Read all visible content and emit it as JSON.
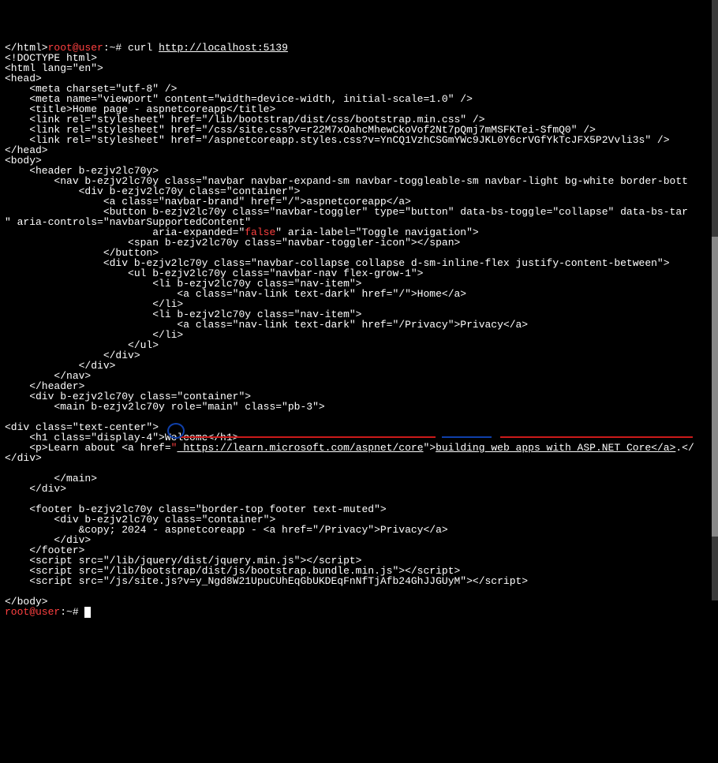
{
  "prompt1_user": "root@user",
  "prompt1_sep": ":~# ",
  "command": "curl ",
  "url": "http://localhost:5139",
  "html_output": {
    "l01": "</html><!DOCTYPE html>",
    "l02": "<html lang=\"en\">",
    "l03": "<head>",
    "l04": "    <meta charset=\"utf-8\" />",
    "l05": "    <meta name=\"viewport\" content=\"width=device-width, initial-scale=1.0\" />",
    "l06": "    <title>Home page - aspnetcoreapp</title>",
    "l07": "    <link rel=\"stylesheet\" href=\"/lib/bootstrap/dist/css/bootstrap.min.css\" />",
    "l08": "    <link rel=\"stylesheet\" href=\"/css/site.css?v=r22M7xOahcMhewCkoVof2Nt7pQmj7mMSFKTei-SfmQ0\" />",
    "l09": "    <link rel=\"stylesheet\" href=\"/aspnetcoreapp.styles.css?v=YnCQ1VzhCSGmYWc9JKL0Y6crVGfYkTcJFX5P2Vvli3s\" />",
    "l10": "</head>",
    "l11": "<body>",
    "l12": "    <header b-ezjv2lc70y>",
    "l13": "        <nav b-ezjv2lc70y class=\"navbar navbar-expand-sm navbar-toggleable-sm navbar-light bg-white border-bott",
    "l14": "            <div b-ezjv2lc70y class=\"container\">",
    "l15": "                <a class=\"navbar-brand\" href=\"/\">aspnetcoreapp</a>",
    "l16": "                <button b-ezjv2lc70y class=\"navbar-toggler\" type=\"button\" data-bs-toggle=\"collapse\" data-bs-tar",
    "l17": "\" aria-controls=\"navbarSupportedContent\"",
    "l18_a": "                        aria-expanded=\"",
    "l18_false": "false",
    "l18_b": "\" aria-label=\"Toggle navigation\">",
    "l19": "                    <span b-ezjv2lc70y class=\"navbar-toggler-icon\"></span>",
    "l20": "                </button>",
    "l21": "                <div b-ezjv2lc70y class=\"navbar-collapse collapse d-sm-inline-flex justify-content-between\">",
    "l22": "                    <ul b-ezjv2lc70y class=\"navbar-nav flex-grow-1\">",
    "l23": "                        <li b-ezjv2lc70y class=\"nav-item\">",
    "l24": "                            <a class=\"nav-link text-dark\" href=\"/\">Home</a>",
    "l25": "                        </li>",
    "l26": "                        <li b-ezjv2lc70y class=\"nav-item\">",
    "l27": "                            <a class=\"nav-link text-dark\" href=\"/Privacy\">Privacy</a>",
    "l28": "                        </li>",
    "l29": "                    </ul>",
    "l30": "                </div>",
    "l31": "            </div>",
    "l32": "        </nav>",
    "l33": "    </header>",
    "l34": "    <div b-ezjv2lc70y class=\"container\">",
    "l35": "        <main b-ezjv2lc70y role=\"main\" class=\"pb-3\">",
    "l36": "",
    "l37": "<div class=\"text-center\">",
    "l38": "    <h1 class=\"display-4\">Welcome</h1>",
    "l39_a": "    <p>Learn about <a href=",
    "l39_url": " https://learn.microsoft.com/aspnet/core",
    "l39_b": "\">",
    "l39_link": "building web apps with ASP.NET Core</a>",
    "l39_c": ".</",
    "l40": "</div>",
    "l41": "",
    "l42": "        </main>",
    "l43": "    </div>",
    "l44": "",
    "l45": "    <footer b-ezjv2lc70y class=\"border-top footer text-muted\">",
    "l46": "        <div b-ezjv2lc70y class=\"container\">",
    "l47": "            &copy; 2024 - aspnetcoreapp - <a href=\"/Privacy\">Privacy</a>",
    "l48": "        </div>",
    "l49": "    </footer>",
    "l50": "    <script src=\"/lib/jquery/dist/jquery.min.js\"></scr",
    "l50b": "ipt>",
    "l51": "    <script src=\"/lib/bootstrap/dist/js/bootstrap.bundle.min.js\"></scr",
    "l51b": "ipt>",
    "l52": "    <script src=\"/js/site.js?v=y_Ngd8W21UpuCUhEqGbUKDEqFnNfTjAfb24GhJJGUyM\"></scr",
    "l52b": "ipt>",
    "l53": "",
    "l54": "</body>"
  },
  "prompt2_user": "root@user",
  "prompt2_sep": ":~# "
}
